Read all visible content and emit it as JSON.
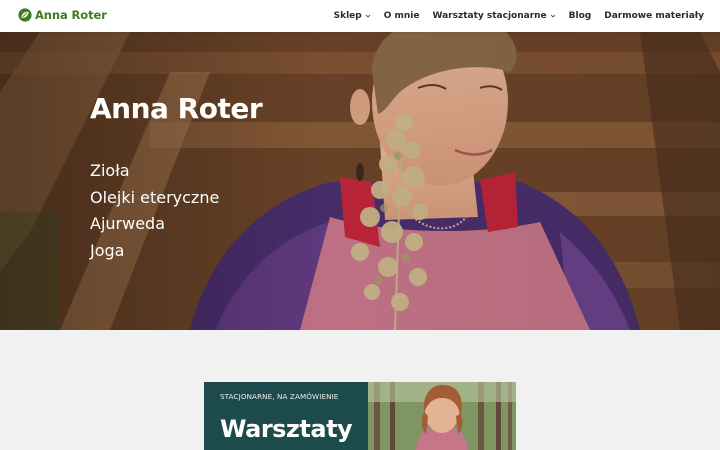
{
  "header": {
    "logo_text": "Anna Roter",
    "nav": [
      {
        "label": "Sklep",
        "has_dropdown": true
      },
      {
        "label": "O mnie",
        "has_dropdown": false
      },
      {
        "label": "Warsztaty stacjonarne",
        "has_dropdown": true
      },
      {
        "label": "Blog",
        "has_dropdown": false
      },
      {
        "label": "Darmowe materiały",
        "has_dropdown": false
      }
    ]
  },
  "hero": {
    "title": "Anna Roter",
    "items": [
      "Zioła",
      "Olejki eteryczne",
      "Ajurweda",
      "Joga"
    ]
  },
  "banner": {
    "kicker": "STACJONARNE, NA ZAMÓWIENIE",
    "title": "Warsztaty"
  },
  "colors": {
    "brand_green": "#3f7a20",
    "banner_teal": "#1d4a4a",
    "section_bg": "#f1f1f1"
  },
  "icons": {
    "logo": "leaf-globe-icon",
    "dropdown": "chevron-down-icon"
  }
}
